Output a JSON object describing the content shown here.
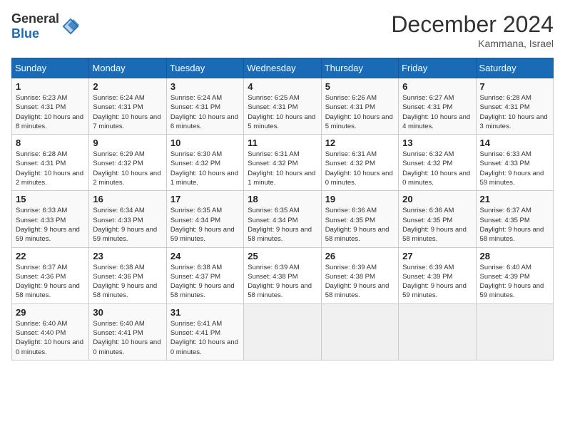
{
  "header": {
    "logo_general": "General",
    "logo_blue": "Blue",
    "month_title": "December 2024",
    "location": "Kammana, Israel"
  },
  "days_of_week": [
    "Sunday",
    "Monday",
    "Tuesday",
    "Wednesday",
    "Thursday",
    "Friday",
    "Saturday"
  ],
  "weeks": [
    [
      {
        "day": "1",
        "sunrise": "6:23 AM",
        "sunset": "4:31 PM",
        "daylight": "10 hours and 8 minutes."
      },
      {
        "day": "2",
        "sunrise": "6:24 AM",
        "sunset": "4:31 PM",
        "daylight": "10 hours and 7 minutes."
      },
      {
        "day": "3",
        "sunrise": "6:24 AM",
        "sunset": "4:31 PM",
        "daylight": "10 hours and 6 minutes."
      },
      {
        "day": "4",
        "sunrise": "6:25 AM",
        "sunset": "4:31 PM",
        "daylight": "10 hours and 5 minutes."
      },
      {
        "day": "5",
        "sunrise": "6:26 AM",
        "sunset": "4:31 PM",
        "daylight": "10 hours and 5 minutes."
      },
      {
        "day": "6",
        "sunrise": "6:27 AM",
        "sunset": "4:31 PM",
        "daylight": "10 hours and 4 minutes."
      },
      {
        "day": "7",
        "sunrise": "6:28 AM",
        "sunset": "4:31 PM",
        "daylight": "10 hours and 3 minutes."
      }
    ],
    [
      {
        "day": "8",
        "sunrise": "6:28 AM",
        "sunset": "4:31 PM",
        "daylight": "10 hours and 2 minutes."
      },
      {
        "day": "9",
        "sunrise": "6:29 AM",
        "sunset": "4:32 PM",
        "daylight": "10 hours and 2 minutes."
      },
      {
        "day": "10",
        "sunrise": "6:30 AM",
        "sunset": "4:32 PM",
        "daylight": "10 hours and 1 minute."
      },
      {
        "day": "11",
        "sunrise": "6:31 AM",
        "sunset": "4:32 PM",
        "daylight": "10 hours and 1 minute."
      },
      {
        "day": "12",
        "sunrise": "6:31 AM",
        "sunset": "4:32 PM",
        "daylight": "10 hours and 0 minutes."
      },
      {
        "day": "13",
        "sunrise": "6:32 AM",
        "sunset": "4:32 PM",
        "daylight": "10 hours and 0 minutes."
      },
      {
        "day": "14",
        "sunrise": "6:33 AM",
        "sunset": "4:33 PM",
        "daylight": "9 hours and 59 minutes."
      }
    ],
    [
      {
        "day": "15",
        "sunrise": "6:33 AM",
        "sunset": "4:33 PM",
        "daylight": "9 hours and 59 minutes."
      },
      {
        "day": "16",
        "sunrise": "6:34 AM",
        "sunset": "4:33 PM",
        "daylight": "9 hours and 59 minutes."
      },
      {
        "day": "17",
        "sunrise": "6:35 AM",
        "sunset": "4:34 PM",
        "daylight": "9 hours and 59 minutes."
      },
      {
        "day": "18",
        "sunrise": "6:35 AM",
        "sunset": "4:34 PM",
        "daylight": "9 hours and 58 minutes."
      },
      {
        "day": "19",
        "sunrise": "6:36 AM",
        "sunset": "4:35 PM",
        "daylight": "9 hours and 58 minutes."
      },
      {
        "day": "20",
        "sunrise": "6:36 AM",
        "sunset": "4:35 PM",
        "daylight": "9 hours and 58 minutes."
      },
      {
        "day": "21",
        "sunrise": "6:37 AM",
        "sunset": "4:35 PM",
        "daylight": "9 hours and 58 minutes."
      }
    ],
    [
      {
        "day": "22",
        "sunrise": "6:37 AM",
        "sunset": "4:36 PM",
        "daylight": "9 hours and 58 minutes."
      },
      {
        "day": "23",
        "sunrise": "6:38 AM",
        "sunset": "4:36 PM",
        "daylight": "9 hours and 58 minutes."
      },
      {
        "day": "24",
        "sunrise": "6:38 AM",
        "sunset": "4:37 PM",
        "daylight": "9 hours and 58 minutes."
      },
      {
        "day": "25",
        "sunrise": "6:39 AM",
        "sunset": "4:38 PM",
        "daylight": "9 hours and 58 minutes."
      },
      {
        "day": "26",
        "sunrise": "6:39 AM",
        "sunset": "4:38 PM",
        "daylight": "9 hours and 58 minutes."
      },
      {
        "day": "27",
        "sunrise": "6:39 AM",
        "sunset": "4:39 PM",
        "daylight": "9 hours and 59 minutes."
      },
      {
        "day": "28",
        "sunrise": "6:40 AM",
        "sunset": "4:39 PM",
        "daylight": "9 hours and 59 minutes."
      }
    ],
    [
      {
        "day": "29",
        "sunrise": "6:40 AM",
        "sunset": "4:40 PM",
        "daylight": "10 hours and 0 minutes."
      },
      {
        "day": "30",
        "sunrise": "6:40 AM",
        "sunset": "4:41 PM",
        "daylight": "10 hours and 0 minutes."
      },
      {
        "day": "31",
        "sunrise": "6:41 AM",
        "sunset": "4:41 PM",
        "daylight": "10 hours and 0 minutes."
      },
      null,
      null,
      null,
      null
    ]
  ],
  "labels": {
    "sunrise": "Sunrise:",
    "sunset": "Sunset:",
    "daylight": "Daylight:"
  }
}
